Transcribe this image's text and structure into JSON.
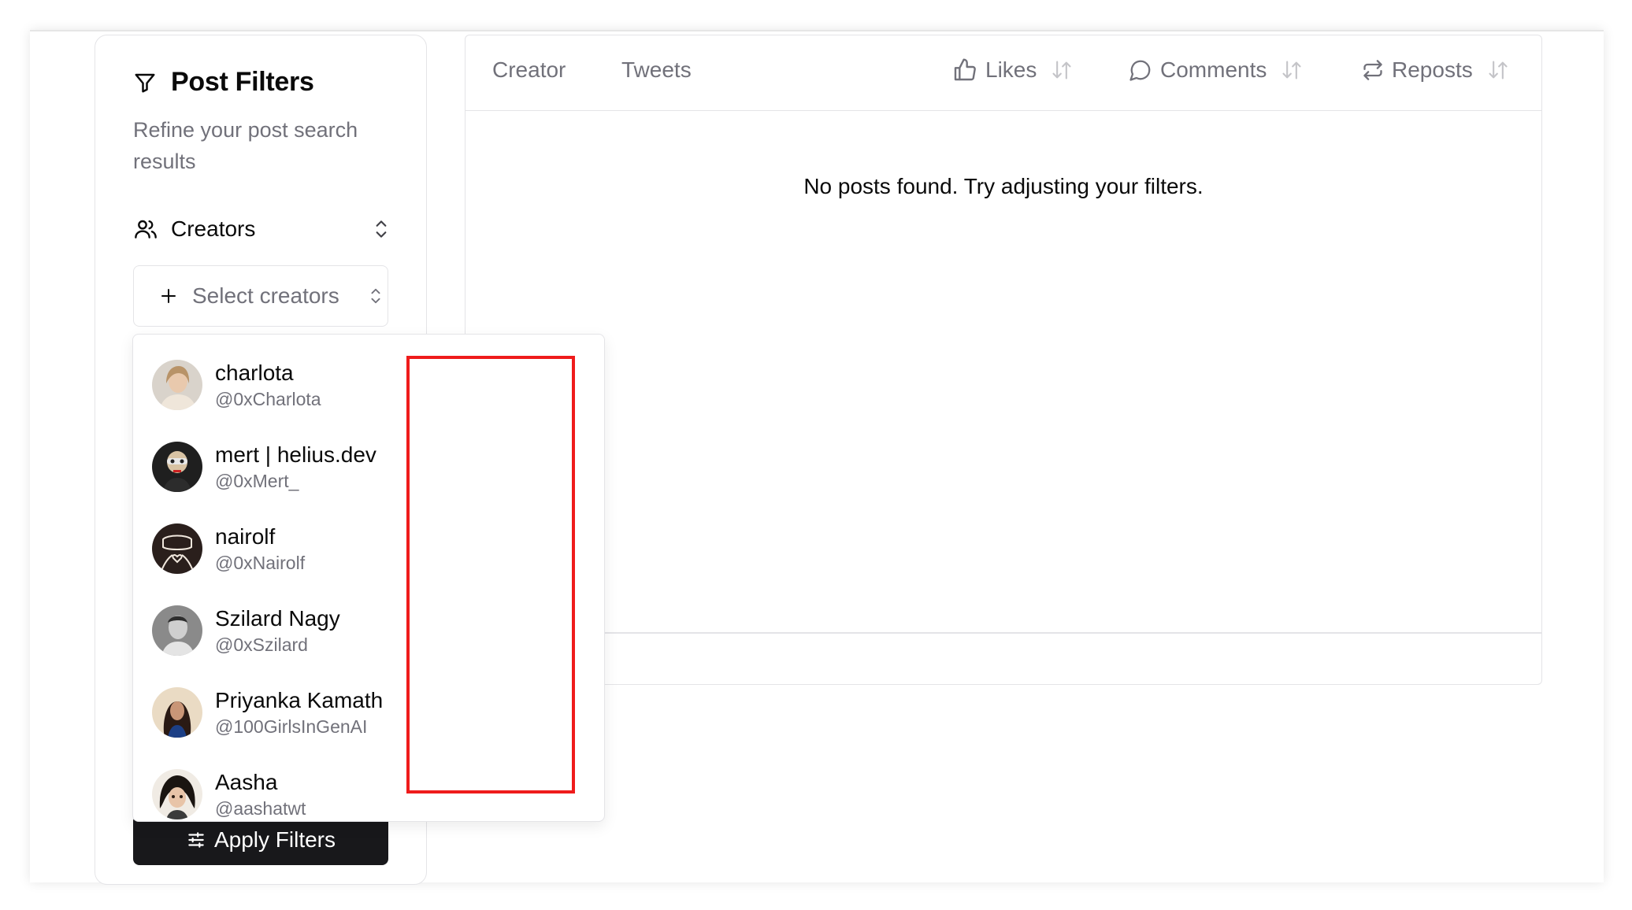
{
  "sidebar": {
    "title": "Post Filters",
    "subtitle": "Refine your post search results",
    "creators_label": "Creators",
    "select_placeholder": "Select creators",
    "apply_label": "Apply Filters"
  },
  "table": {
    "columns": {
      "creator": "Creator",
      "tweets": "Tweets",
      "likes": "Likes",
      "comments": "Comments",
      "reposts": "Reposts"
    },
    "empty_message": "No posts found. Try adjusting your filters."
  },
  "dropdown": {
    "creators": [
      {
        "name": "charlota",
        "handle": "@0xCharlota"
      },
      {
        "name": "mert | helius.dev",
        "handle": "@0xMert_"
      },
      {
        "name": "nairolf",
        "handle": "@0xNairolf"
      },
      {
        "name": "Szilard Nagy",
        "handle": "@0xSzilard"
      },
      {
        "name": "Priyanka Kamath",
        "handle": "@100GirlsInGenAI"
      },
      {
        "name": "Aasha",
        "handle": "@aashatwt"
      }
    ]
  },
  "colors": {
    "highlight_box": "#ef1b1b",
    "primary_button": "#18181b",
    "muted_text": "#71717a",
    "border": "#e4e4e7"
  },
  "icons": {
    "title": "filter-icon",
    "creators": "users-icon",
    "select": "plus-icon",
    "likes": "thumbs-up-icon",
    "comments": "message-circle-icon",
    "reposts": "repeat-icon",
    "sort": "arrow-up-down-icon",
    "apply": "sliders-icon"
  }
}
